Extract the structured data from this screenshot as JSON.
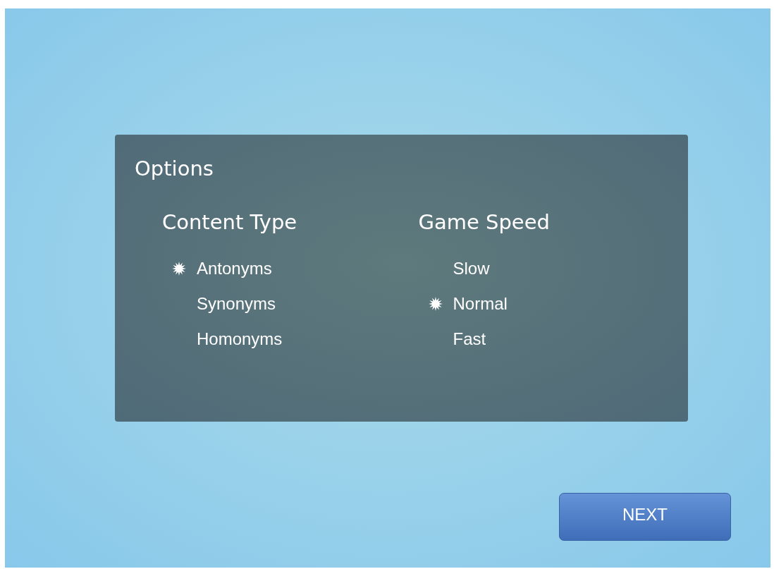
{
  "panel": {
    "title": "Options",
    "groups": [
      {
        "heading": "Content Type",
        "options": [
          {
            "label": "Antonyms",
            "selected": true
          },
          {
            "label": "Synonyms",
            "selected": false
          },
          {
            "label": "Homonyms",
            "selected": false
          }
        ]
      },
      {
        "heading": "Game Speed",
        "options": [
          {
            "label": "Slow",
            "selected": false
          },
          {
            "label": "Normal",
            "selected": true
          },
          {
            "label": "Fast",
            "selected": false
          }
        ]
      }
    ]
  },
  "button": {
    "label": "NEXT"
  }
}
